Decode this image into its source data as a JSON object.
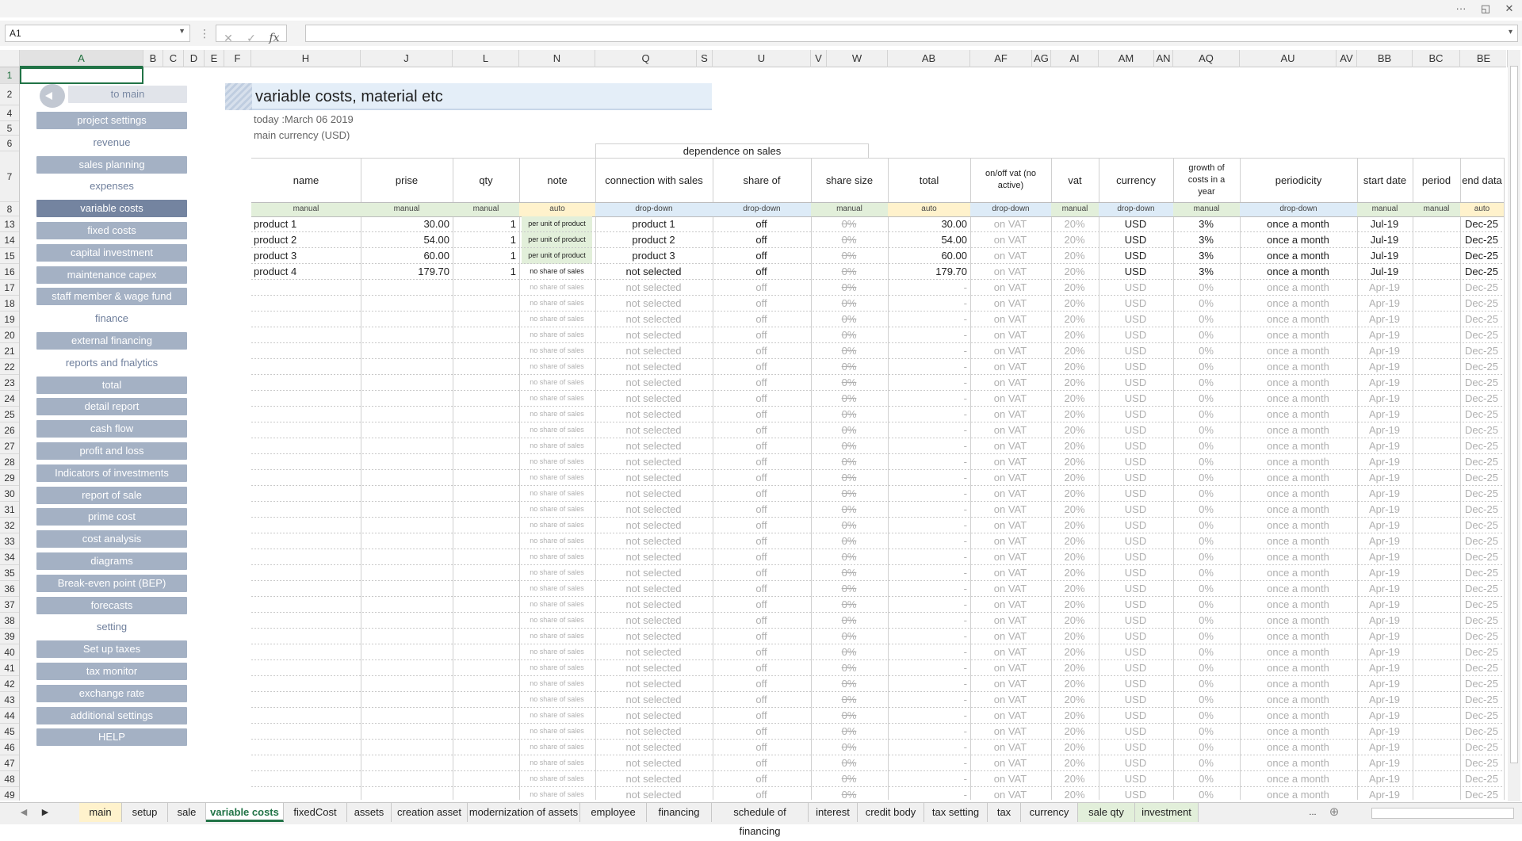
{
  "window": {
    "more": "···",
    "restore": "◱",
    "close": "✕"
  },
  "formula_bar": {
    "cell_ref": "A1",
    "cancel": "✕",
    "enter": "✓",
    "fx": "fx",
    "content": ""
  },
  "columns": [
    "A",
    "B",
    "C",
    "D",
    "E",
    "F",
    "H",
    "J",
    "L",
    "N",
    "Q",
    "S",
    "U",
    "V",
    "W",
    "AB",
    "AF",
    "AG",
    "AI",
    "AM",
    "AN",
    "AQ",
    "AU",
    "AV",
    "BB",
    "BC",
    "BE"
  ],
  "rows": [
    "1",
    "2",
    "4",
    "5",
    "6",
    "7",
    "8",
    "13",
    "14",
    "15",
    "16",
    "17",
    "18",
    "19",
    "20",
    "21",
    "22",
    "23",
    "24",
    "25",
    "26",
    "27",
    "28",
    "29",
    "30",
    "31",
    "32",
    "33",
    "34",
    "35",
    "36",
    "37",
    "38",
    "39",
    "40",
    "41",
    "42",
    "43",
    "44",
    "45",
    "46",
    "47",
    "48",
    "49"
  ],
  "menu": {
    "to_main": "to main",
    "items": [
      {
        "label": "project settings",
        "kind": "button"
      },
      {
        "label": "revenue",
        "kind": "section"
      },
      {
        "label": "sales planning",
        "kind": "button"
      },
      {
        "label": "expenses",
        "kind": "section"
      },
      {
        "label": "variable costs",
        "kind": "active"
      },
      {
        "label": "fixed costs",
        "kind": "button"
      },
      {
        "label": "capital investment",
        "kind": "button"
      },
      {
        "label": "maintenance capex",
        "kind": "button"
      },
      {
        "label": "staff member & wage fund",
        "kind": "button"
      },
      {
        "label": "finance",
        "kind": "section"
      },
      {
        "label": "external financing",
        "kind": "button"
      },
      {
        "label": "reports and fnalytics",
        "kind": "section"
      },
      {
        "label": "total",
        "kind": "button"
      },
      {
        "label": "detail report",
        "kind": "button"
      },
      {
        "label": "cash flow",
        "kind": "button"
      },
      {
        "label": "profit and loss",
        "kind": "button"
      },
      {
        "label": "Indicators of investments",
        "kind": "button"
      },
      {
        "label": "report of sale",
        "kind": "button"
      },
      {
        "label": "prime cost",
        "kind": "button"
      },
      {
        "label": "cost analysis",
        "kind": "button"
      },
      {
        "label": "diagrams",
        "kind": "button"
      },
      {
        "label": "Break-even point (BEP)",
        "kind": "button"
      },
      {
        "label": "forecasts",
        "kind": "button"
      },
      {
        "label": "setting",
        "kind": "section"
      },
      {
        "label": "Set up taxes",
        "kind": "button"
      },
      {
        "label": "tax monitor",
        "kind": "button"
      },
      {
        "label": "exchange rate",
        "kind": "button"
      },
      {
        "label": "additional settings",
        "kind": "button"
      },
      {
        "label": "HELP",
        "kind": "button"
      }
    ]
  },
  "page": {
    "title": "variable costs, material etc",
    "today": "today :March 06 2019",
    "currency": "main currency (USD)",
    "group_header": "dependence on sales"
  },
  "table": {
    "headers": [
      "name",
      "prise",
      "qty",
      "note",
      "connection with sales",
      "share of",
      "share size",
      "total",
      "on/off vat (no active)",
      "vat",
      "currency",
      "growth of costs  in a year",
      "periodicity",
      "start date",
      "period",
      "end data"
    ],
    "types": [
      "manual",
      "manual",
      "manual",
      "auto",
      "drop-down",
      "drop-down",
      "manual",
      "auto",
      "drop-down",
      "manual",
      "drop-down",
      "manual",
      "drop-down",
      "manual",
      "manual",
      "auto"
    ],
    "type_colors": {
      "manual": "#e2efda",
      "auto": "#fff2cc",
      "drop-down": "#ddebf7"
    },
    "rows": [
      {
        "name": "product 1",
        "prise": "30.00",
        "qty": "1",
        "note": "per unit of product",
        "connection": "product 1",
        "share_of": "off",
        "share_size": "0%",
        "total": "30.00",
        "vat_onoff": "on VAT",
        "vat": "20%",
        "currency": "USD",
        "growth": "3%",
        "periodicity": "once a month",
        "start": "Jul-19",
        "period": "",
        "end": "Dec-25"
      },
      {
        "name": "product 2",
        "prise": "54.00",
        "qty": "1",
        "note": "per unit of product",
        "connection": "product 2",
        "share_of": "off",
        "share_size": "0%",
        "total": "54.00",
        "vat_onoff": "on VAT",
        "vat": "20%",
        "currency": "USD",
        "growth": "3%",
        "periodicity": "once a month",
        "start": "Jul-19",
        "period": "",
        "end": "Dec-25"
      },
      {
        "name": "product 3",
        "prise": "60.00",
        "qty": "1",
        "note": "per unit of product",
        "connection": "product 3",
        "share_of": "off",
        "share_size": "0%",
        "total": "60.00",
        "vat_onoff": "on VAT",
        "vat": "20%",
        "currency": "USD",
        "growth": "3%",
        "periodicity": "once a month",
        "start": "Jul-19",
        "period": "",
        "end": "Dec-25"
      },
      {
        "name": "product 4",
        "prise": "179.70",
        "qty": "1",
        "note": "no share of sales",
        "connection": "not selected",
        "share_of": "off",
        "share_size": "0%",
        "total": "179.70",
        "vat_onoff": "on VAT",
        "vat": "20%",
        "currency": "USD",
        "growth": "3%",
        "periodicity": "once a month",
        "start": "Jul-19",
        "period": "",
        "end": "Dec-25"
      }
    ],
    "empty_row": {
      "name": "",
      "prise": "",
      "qty": "",
      "note": "no share of sales",
      "connection": "not selected",
      "share_of": "off",
      "share_size": "0%",
      "total": "-",
      "vat_onoff": "on VAT",
      "vat": "20%",
      "currency": "USD",
      "growth": "0%",
      "periodicity": "once a month",
      "start": "Apr-19",
      "period": "",
      "end": "Dec-25"
    },
    "empty_row_count": 33
  },
  "sheet_tabs": [
    {
      "label": "main",
      "style": "cream"
    },
    {
      "label": "setup",
      "style": ""
    },
    {
      "label": "sale",
      "style": ""
    },
    {
      "label": "variable costs",
      "style": "active"
    },
    {
      "label": "fixedCost",
      "style": ""
    },
    {
      "label": "assets",
      "style": ""
    },
    {
      "label": "creation asset",
      "style": ""
    },
    {
      "label": "modernization of assets",
      "style": ""
    },
    {
      "label": "employee",
      "style": ""
    },
    {
      "label": "financing",
      "style": ""
    },
    {
      "label": "schedule of financing",
      "style": ""
    },
    {
      "label": "interest",
      "style": ""
    },
    {
      "label": "credit body",
      "style": ""
    },
    {
      "label": "tax setting",
      "style": ""
    },
    {
      "label": "tax",
      "style": ""
    },
    {
      "label": "currency",
      "style": ""
    },
    {
      "label": "sale qty",
      "style": "green"
    },
    {
      "label": "investment",
      "style": "green"
    }
  ],
  "tab_nav": {
    "prev": "◀",
    "next": "▶",
    "more": "...",
    "add": "⊕"
  }
}
